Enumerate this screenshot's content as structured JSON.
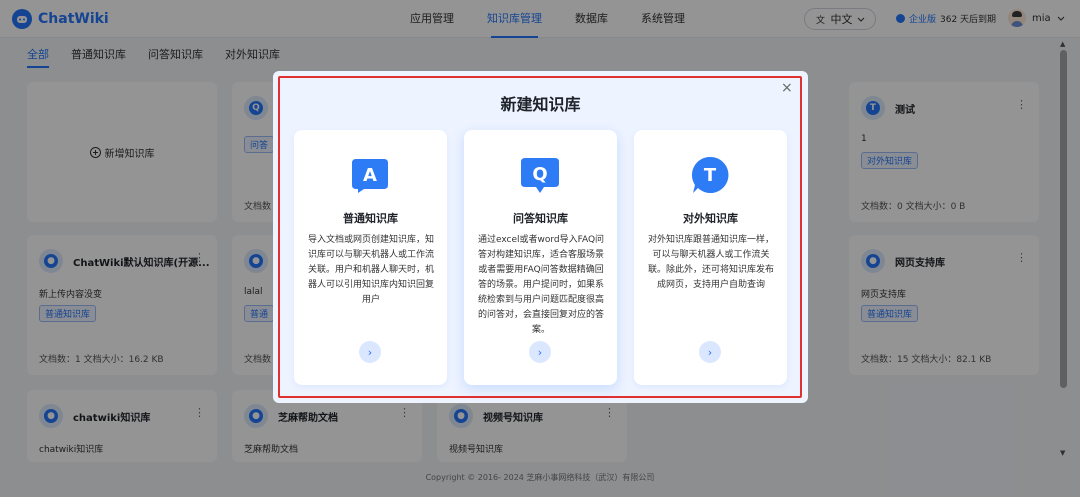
{
  "app": {
    "name": "ChatWiki"
  },
  "nav": {
    "items": [
      "应用管理",
      "知识库管理",
      "数据库",
      "系统管理"
    ],
    "active": "知识库管理"
  },
  "lang": {
    "label": "中文"
  },
  "enterprise": {
    "label": "企业版",
    "expiry": "362 天后到期"
  },
  "user": {
    "name": "mia"
  },
  "subtabs": {
    "items": [
      "全部",
      "普通知识库",
      "问答知识库",
      "对外知识库"
    ],
    "active": "全部"
  },
  "new_kb": {
    "label": "新增知识库"
  },
  "cards": [
    {
      "title": "",
      "desc": "",
      "tag": "问答",
      "stat": "文档数"
    },
    {
      "title": "测试",
      "desc": "1",
      "tag": "对外知识库",
      "stat": "文档数：0    文档大小：0 B",
      "icon_letter": "T"
    },
    {
      "title": "ChatWiki默认知识库(开源...",
      "desc": "新上传内容没变",
      "tag": "普通知识库",
      "stat": "文档数：1    文档大小：16.2 KB"
    },
    {
      "title": "",
      "desc": "lalal",
      "tag": "普通",
      "stat": "文档数"
    },
    {
      "title": "网页支持库",
      "desc": "网页支持库",
      "tag": "普通知识库",
      "stat": "文档数：15    文档大小：82.1 KB"
    },
    {
      "title": "chatwiki知识库",
      "desc": "chatwiki知识库",
      "tag": "",
      "stat": ""
    },
    {
      "title": "芝麻帮助文档",
      "desc": "芝麻帮助文档",
      "tag": "",
      "stat": ""
    },
    {
      "title": "视频号知识库",
      "desc": "视频号知识库",
      "tag": "",
      "stat": ""
    }
  ],
  "footer": {
    "text": "Copyright © 2016- 2024 芝麻小事网络科技（武汉）有限公司"
  },
  "modal": {
    "title": "新建知识库",
    "close": "×",
    "types": [
      {
        "letter": "A",
        "name": "普通知识库",
        "desc": "导入文档或网页创建知识库，知识库可以与聊天机器人或工作流关联。用户和机器人聊天时，机器人可以引用知识库内知识回复用户",
        "arrow": "›"
      },
      {
        "letter": "Q",
        "name": "问答知识库",
        "desc": "通过excel或者word导入FAQ问答对构建知识库，适合客服场景或者需要用FAQ问答数据精确回答的场景。用户提问时，如果系统检索到与用户问题匹配度很高的问答对，会直接回复对应的答案。",
        "arrow": "›"
      },
      {
        "letter": "T",
        "name": "对外知识库",
        "desc": "对外知识库跟普通知识库一样，可以与聊天机器人或工作流关联。除此外，还可将知识库发布成网页，支持用户自助查询",
        "arrow": "›"
      }
    ]
  },
  "colors": {
    "accent": "#2475fc",
    "highlight": "#e03131"
  }
}
